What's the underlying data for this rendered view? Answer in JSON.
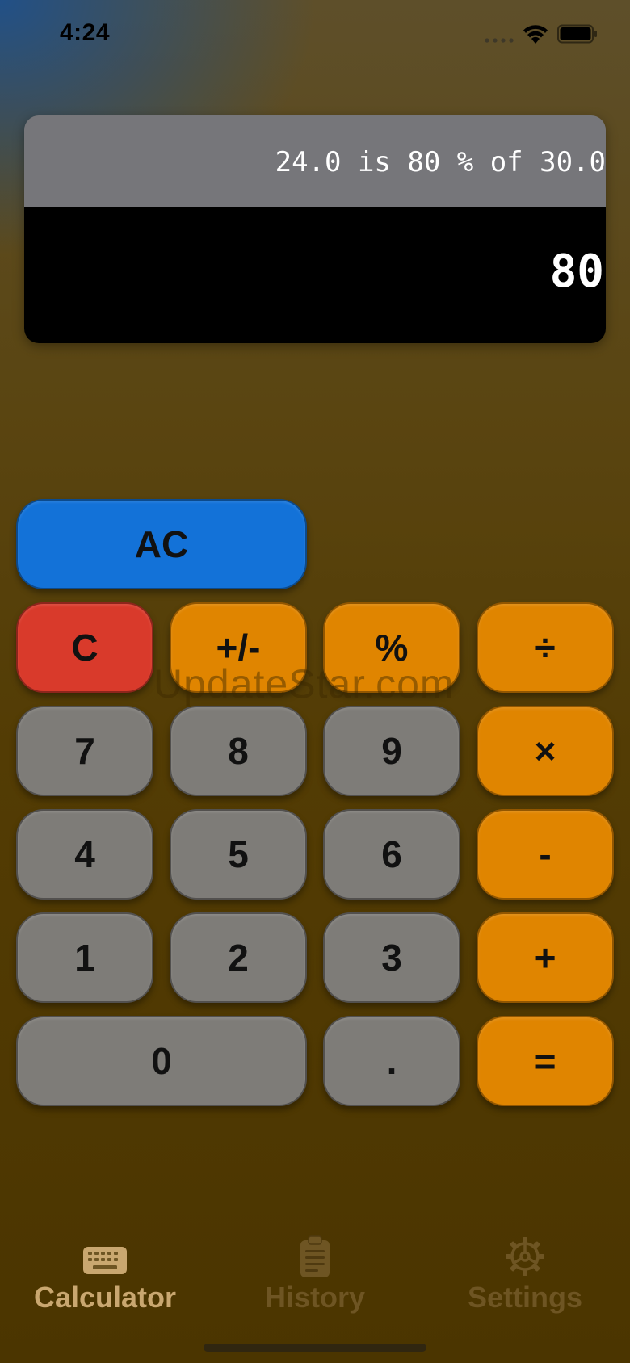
{
  "status_bar": {
    "time": "4:24"
  },
  "display": {
    "expression": "24.0 is 80 % of 30.0",
    "result": "80"
  },
  "keypad": {
    "rows": [
      [
        {
          "id": "ac",
          "label": "AC"
        }
      ],
      [
        {
          "id": "clear",
          "label": "C"
        },
        {
          "id": "sign",
          "label": "+/-"
        },
        {
          "id": "percent",
          "label": "%"
        },
        {
          "id": "divide",
          "label": "÷"
        }
      ],
      [
        {
          "id": "seven",
          "label": "7"
        },
        {
          "id": "eight",
          "label": "8"
        },
        {
          "id": "nine",
          "label": "9"
        },
        {
          "id": "multiply",
          "label": "×"
        }
      ],
      [
        {
          "id": "four",
          "label": "4"
        },
        {
          "id": "five",
          "label": "5"
        },
        {
          "id": "six",
          "label": "6"
        },
        {
          "id": "subtract",
          "label": "-"
        }
      ],
      [
        {
          "id": "one",
          "label": "1"
        },
        {
          "id": "two",
          "label": "2"
        },
        {
          "id": "three",
          "label": "3"
        },
        {
          "id": "add",
          "label": "+"
        }
      ],
      [
        {
          "id": "zero",
          "label": "0"
        },
        {
          "id": "decimal",
          "label": "."
        },
        {
          "id": "equals",
          "label": "="
        }
      ]
    ]
  },
  "watermark": "UpdateStar.com",
  "tabs": [
    {
      "label": "Calculator",
      "icon": "keyboard-icon",
      "active": true
    },
    {
      "label": "History",
      "icon": "clipboard-icon",
      "active": false
    },
    {
      "label": "Settings",
      "icon": "gear-icon",
      "active": false
    }
  ],
  "colors": {
    "accent_orange": "#e08500",
    "clear_red": "#d93a2b",
    "ac_blue": "#1372d8",
    "digit_gray": "#7e7c78",
    "active_tab": "#c9a770",
    "inactive_tab": "#6e5523"
  }
}
